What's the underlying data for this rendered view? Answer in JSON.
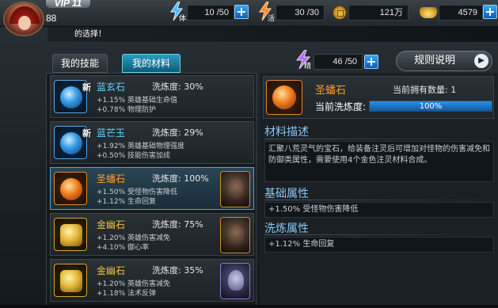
{
  "player": {
    "vip_label": "VIP 11",
    "level": "88"
  },
  "resources": {
    "stamina": {
      "tag": "体",
      "value": "10 /50"
    },
    "vitality": {
      "tag": "活",
      "value": "30 /30"
    },
    "gold": {
      "value": "121万"
    },
    "ingot": {
      "value": "4579"
    }
  },
  "ticker": {
    "text": "的选择！"
  },
  "tabs": [
    {
      "label": "我的技能",
      "active": false
    },
    {
      "label": "我的材料",
      "active": true
    }
  ],
  "energy": {
    "tag": "精",
    "value": "46 /50"
  },
  "rules_button": {
    "label": "规则说明"
  },
  "materials": [
    {
      "new": "新",
      "name": "蓝玄石",
      "refine": "洗炼度: 30%",
      "line1": "+1.15% 英雄基础生命值",
      "line2": "+0.78% 物理防护",
      "color": "blue"
    },
    {
      "new": "新",
      "name": "蓝芒玉",
      "refine": "洗炼度: 29%",
      "line1": "+1.92% 英雄基础物理强度",
      "line2": "+0.50% 技能伤害加成",
      "color": "blue"
    },
    {
      "new": "",
      "name": "圣蟠石",
      "refine": "洗炼度: 100%",
      "line1": "+1.50% 受怪物伤害降低",
      "line2": "+1.12% 生命回复",
      "color": "orange"
    },
    {
      "new": "",
      "name": "金幽石",
      "refine": "洗炼度: 75%",
      "line1": "+1.20% 英雄伤害减免",
      "line2": "+4.10% 御心率",
      "color": "gold"
    },
    {
      "new": "",
      "name": "金幽石",
      "refine": "洗炼度: 35%",
      "line1": "+1.20% 英雄伤害减免",
      "line2": "+1.18% 法术反弹",
      "color": "gold"
    }
  ],
  "detail": {
    "name": "圣蟠石",
    "owned": "当前拥有数量: 1",
    "refine_label": "当前洗炼度:",
    "refine_value": "100%",
    "refine_fraction": 1.0,
    "desc_title": "材料描述",
    "desc_text": "汇聚八荒灵气的宝石，给装备注灵后可增加对怪物的伤害减免和防御类属性，需要使用4个金色注灵材料合成。",
    "base_title": "基础属性",
    "base_text": "+1.50% 受怪物伤害降低",
    "refine_title": "洗炼属性",
    "refine_text": "+1.12% 生命回复"
  },
  "colors": {
    "accent_blue": "#5fd4ff",
    "accent_orange": "#ff9a2a",
    "accent_gold": "#f0c040",
    "section_title": "#88c8f4"
  }
}
